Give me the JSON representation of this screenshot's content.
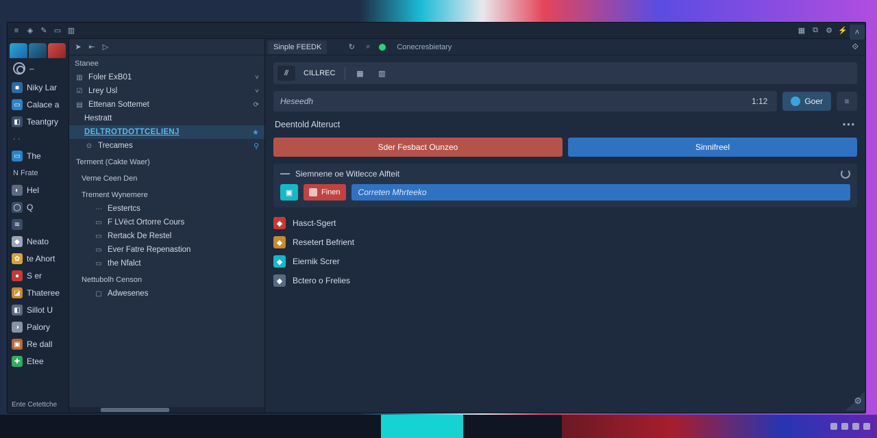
{
  "titlebar": {
    "left_icons": [
      "menu",
      "tag",
      "note",
      "window",
      "panel"
    ],
    "mid_icons": [
      "arrow",
      "back",
      "play"
    ],
    "right_icons": [
      "grid",
      "copy",
      "gear",
      "bolt",
      "bars"
    ]
  },
  "sidebar": {
    "avatar_caret": "–",
    "tabs": 3,
    "items": [
      {
        "label": "Niky Lar",
        "color": "#2c6aa1",
        "glyph": "■"
      },
      {
        "label": "Calace a",
        "color": "#2a82c7",
        "glyph": "▭"
      },
      {
        "label": "Teantgry",
        "color": "#3a4c66",
        "glyph": "◧"
      },
      {
        "label": "· ·",
        "plain": true
      },
      {
        "label": "The",
        "color": "#2a82c7",
        "glyph": "▭"
      },
      {
        "label": "N Frate",
        "plain": true
      },
      {
        "label": "Hel",
        "color": "#5a6a82",
        "glyph": "◐"
      },
      {
        "label": "Q",
        "color": "#3a4c66",
        "glyph": "◯"
      },
      {
        "label": " ",
        "color": "#3a4c66",
        "glyph": "≋"
      },
      {
        "label": "Neato",
        "color": "#9aa6b8",
        "glyph": "◆"
      },
      {
        "label": "te Ahort",
        "color": "#d8a23a",
        "glyph": "✿"
      },
      {
        "label": "S er",
        "color": "#c43a36",
        "glyph": "●"
      },
      {
        "label": "Thateree",
        "color": "#c78a2e",
        "glyph": "◪"
      },
      {
        "label": "Sillot U",
        "color": "#5a6a82",
        "glyph": "◧"
      },
      {
        "label": "Palory",
        "color": "#8893a6",
        "glyph": "◑"
      },
      {
        "label": "Re dall",
        "color": "#b6693a",
        "glyph": "▣"
      },
      {
        "label": "Etee",
        "color": "#2fae5c",
        "glyph": "✚"
      }
    ],
    "footer": "Ente Cetettche"
  },
  "mid": {
    "header": "Stanee",
    "tree": [
      {
        "kind": "row",
        "label": "Foler ExB01",
        "ico": "▥",
        "chev": "˅"
      },
      {
        "kind": "row",
        "label": "Lrey Usl",
        "ico": "☑",
        "chev": "˅"
      },
      {
        "kind": "row",
        "label": "Ettenan Sottemet",
        "ico": "▤",
        "chev": "⟳"
      },
      {
        "kind": "row",
        "label": "Hestratt",
        "indent": 1
      },
      {
        "kind": "row",
        "label": "DELTROTDOTTCELIENJ",
        "indent": 1,
        "sel": true,
        "pin": "★"
      },
      {
        "kind": "row",
        "label": "Trecames",
        "indent": 1,
        "ico": "⊙",
        "pin": "⚲"
      },
      {
        "kind": "group",
        "label": "Terment (Cakte Waer)"
      },
      {
        "kind": "group",
        "label": "Verne Ceen Den",
        "indent": 1
      },
      {
        "kind": "group",
        "label": "Trement Wynemere",
        "indent": 1
      },
      {
        "kind": "row",
        "label": "Eestertcs",
        "indent": 2,
        "ico": "⋯"
      },
      {
        "kind": "row",
        "label": "F LVëct Ortorre Cours",
        "indent": 2,
        "ico": "▭"
      },
      {
        "kind": "row",
        "label": "Rertack De Restel",
        "indent": 2,
        "ico": "▭"
      },
      {
        "kind": "row",
        "label": "Ever Fatre Repenastion",
        "indent": 2,
        "ico": "▭"
      },
      {
        "kind": "row",
        "label": "the Nfalct",
        "indent": 2,
        "ico": "▭"
      },
      {
        "kind": "group",
        "label": "Nettubolh Censon",
        "indent": 1
      },
      {
        "kind": "row",
        "label": "Adwesenes",
        "indent": 2,
        "ico": "▢"
      }
    ]
  },
  "right": {
    "tab_a": "Sinple FEEDK",
    "tab_b": "Conecresbietary",
    "refresh": "↻",
    "search": "⌕",
    "gear_right": "⟐",
    "toolbar_text": "CILLREC",
    "search_placeholder": "Heseedh",
    "search_count": "1:12",
    "go_label": "Goer",
    "section_title": "Deentold Alteruct",
    "btn_a": "Sder Fesbact Ounzeo",
    "btn_b": "Sinnifreel",
    "panel_title": "Siemnene oe Witlecce Alfteit",
    "chip_red": "Finen",
    "inline_placeholder": "Correten Mhrteeko",
    "list": [
      {
        "label": "Hasct-Sgert",
        "color": "#c43a36"
      },
      {
        "label": "Resetert Befrient",
        "color": "#c78a2e"
      },
      {
        "label": "Eiernik Screr",
        "color": "#17b8c6"
      },
      {
        "label": "Bctero o Frelies",
        "color": "#5a6a82"
      }
    ]
  }
}
